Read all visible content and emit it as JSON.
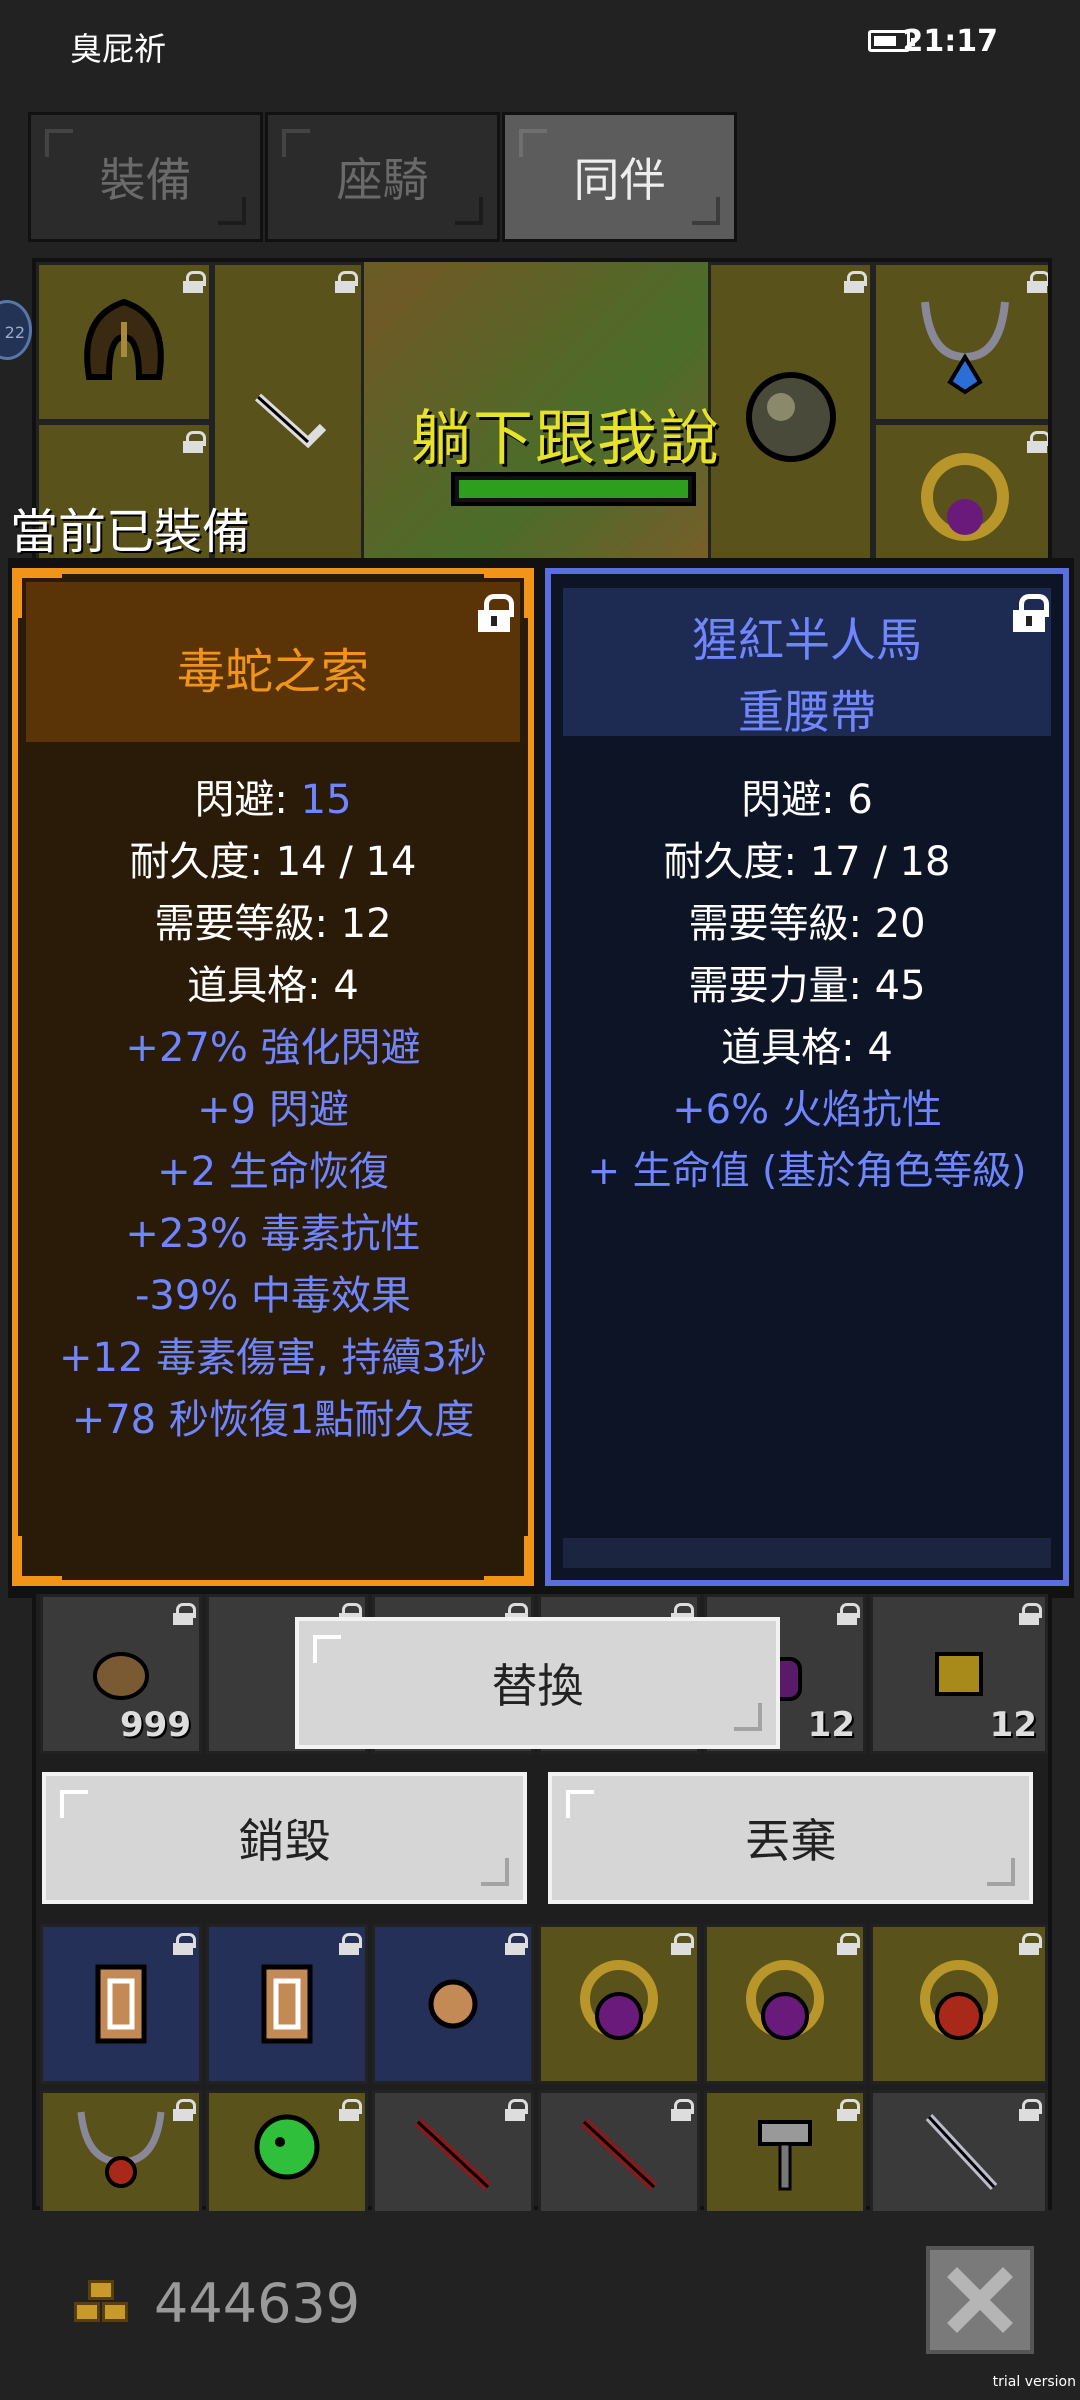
{
  "status_bar": {
    "carrier": "臭屁祈",
    "time": "21:17"
  },
  "tabs": [
    {
      "label": "裝備",
      "active": false
    },
    {
      "label": "座騎",
      "active": false
    },
    {
      "label": "同伴",
      "active": true
    }
  ],
  "scene": {
    "overlay_text": "躺下跟我說",
    "side_badge": "22"
  },
  "equipped_label": "當前已裝備",
  "equipped_item": {
    "name": "毒蛇之索",
    "stats": [
      {
        "label": "閃避: ",
        "value": "15"
      },
      {
        "text": "耐久度: 14 / 14"
      },
      {
        "text": "需要等級: 12"
      },
      {
        "text": "道具格: 4"
      }
    ],
    "bonuses": [
      "+27% 強化閃避",
      "+9 閃避",
      "+2 生命恢復",
      "+23% 毒素抗性",
      "-39% 中毒效果",
      "+12 毒素傷害, 持續3秒",
      "+78 秒恢復1點耐久度"
    ]
  },
  "compared_item": {
    "name_line1": "猩紅半人馬",
    "name_line2": "重腰帶",
    "stats": [
      "閃避: 6",
      "耐久度: 17 / 18",
      "需要等級: 20",
      "需要力量: 45",
      "道具格: 4"
    ],
    "bonuses": [
      "+6% 火焰抗性",
      "+ 生命值 (基於角色等級)"
    ]
  },
  "inventory": {
    "count_1": "999",
    "count_2": "12",
    "count_3": "12"
  },
  "actions": {
    "replace": "替換",
    "destroy": "銷毀",
    "discard": "丟棄"
  },
  "gold": "444639",
  "watermark": "trial version",
  "colors": {
    "legendary_orange": "#f29418",
    "magic_blue": "#6f86ff",
    "rare_border": "#5a6ee0"
  }
}
